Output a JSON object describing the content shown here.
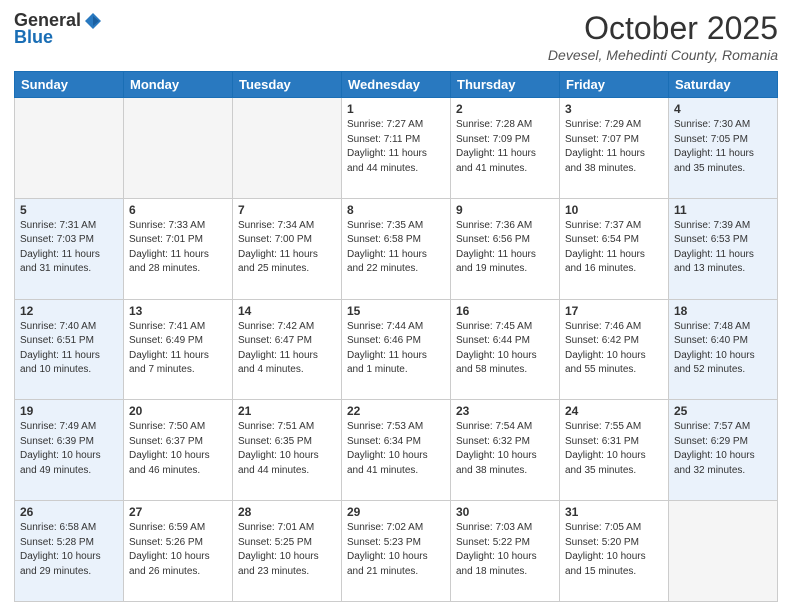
{
  "header": {
    "logo_general": "General",
    "logo_blue": "Blue",
    "month_title": "October 2025",
    "location": "Devesel, Mehedinti County, Romania"
  },
  "days_of_week": [
    "Sunday",
    "Monday",
    "Tuesday",
    "Wednesday",
    "Thursday",
    "Friday",
    "Saturday"
  ],
  "weeks": [
    [
      {
        "day": "",
        "info": ""
      },
      {
        "day": "",
        "info": ""
      },
      {
        "day": "",
        "info": ""
      },
      {
        "day": "1",
        "info": "Sunrise: 7:27 AM\nSunset: 7:11 PM\nDaylight: 11 hours\nand 44 minutes."
      },
      {
        "day": "2",
        "info": "Sunrise: 7:28 AM\nSunset: 7:09 PM\nDaylight: 11 hours\nand 41 minutes."
      },
      {
        "day": "3",
        "info": "Sunrise: 7:29 AM\nSunset: 7:07 PM\nDaylight: 11 hours\nand 38 minutes."
      },
      {
        "day": "4",
        "info": "Sunrise: 7:30 AM\nSunset: 7:05 PM\nDaylight: 11 hours\nand 35 minutes."
      }
    ],
    [
      {
        "day": "5",
        "info": "Sunrise: 7:31 AM\nSunset: 7:03 PM\nDaylight: 11 hours\nand 31 minutes."
      },
      {
        "day": "6",
        "info": "Sunrise: 7:33 AM\nSunset: 7:01 PM\nDaylight: 11 hours\nand 28 minutes."
      },
      {
        "day": "7",
        "info": "Sunrise: 7:34 AM\nSunset: 7:00 PM\nDaylight: 11 hours\nand 25 minutes."
      },
      {
        "day": "8",
        "info": "Sunrise: 7:35 AM\nSunset: 6:58 PM\nDaylight: 11 hours\nand 22 minutes."
      },
      {
        "day": "9",
        "info": "Sunrise: 7:36 AM\nSunset: 6:56 PM\nDaylight: 11 hours\nand 19 minutes."
      },
      {
        "day": "10",
        "info": "Sunrise: 7:37 AM\nSunset: 6:54 PM\nDaylight: 11 hours\nand 16 minutes."
      },
      {
        "day": "11",
        "info": "Sunrise: 7:39 AM\nSunset: 6:53 PM\nDaylight: 11 hours\nand 13 minutes."
      }
    ],
    [
      {
        "day": "12",
        "info": "Sunrise: 7:40 AM\nSunset: 6:51 PM\nDaylight: 11 hours\nand 10 minutes."
      },
      {
        "day": "13",
        "info": "Sunrise: 7:41 AM\nSunset: 6:49 PM\nDaylight: 11 hours\nand 7 minutes."
      },
      {
        "day": "14",
        "info": "Sunrise: 7:42 AM\nSunset: 6:47 PM\nDaylight: 11 hours\nand 4 minutes."
      },
      {
        "day": "15",
        "info": "Sunrise: 7:44 AM\nSunset: 6:46 PM\nDaylight: 11 hours\nand 1 minute."
      },
      {
        "day": "16",
        "info": "Sunrise: 7:45 AM\nSunset: 6:44 PM\nDaylight: 10 hours\nand 58 minutes."
      },
      {
        "day": "17",
        "info": "Sunrise: 7:46 AM\nSunset: 6:42 PM\nDaylight: 10 hours\nand 55 minutes."
      },
      {
        "day": "18",
        "info": "Sunrise: 7:48 AM\nSunset: 6:40 PM\nDaylight: 10 hours\nand 52 minutes."
      }
    ],
    [
      {
        "day": "19",
        "info": "Sunrise: 7:49 AM\nSunset: 6:39 PM\nDaylight: 10 hours\nand 49 minutes."
      },
      {
        "day": "20",
        "info": "Sunrise: 7:50 AM\nSunset: 6:37 PM\nDaylight: 10 hours\nand 46 minutes."
      },
      {
        "day": "21",
        "info": "Sunrise: 7:51 AM\nSunset: 6:35 PM\nDaylight: 10 hours\nand 44 minutes."
      },
      {
        "day": "22",
        "info": "Sunrise: 7:53 AM\nSunset: 6:34 PM\nDaylight: 10 hours\nand 41 minutes."
      },
      {
        "day": "23",
        "info": "Sunrise: 7:54 AM\nSunset: 6:32 PM\nDaylight: 10 hours\nand 38 minutes."
      },
      {
        "day": "24",
        "info": "Sunrise: 7:55 AM\nSunset: 6:31 PM\nDaylight: 10 hours\nand 35 minutes."
      },
      {
        "day": "25",
        "info": "Sunrise: 7:57 AM\nSunset: 6:29 PM\nDaylight: 10 hours\nand 32 minutes."
      }
    ],
    [
      {
        "day": "26",
        "info": "Sunrise: 6:58 AM\nSunset: 5:28 PM\nDaylight: 10 hours\nand 29 minutes."
      },
      {
        "day": "27",
        "info": "Sunrise: 6:59 AM\nSunset: 5:26 PM\nDaylight: 10 hours\nand 26 minutes."
      },
      {
        "day": "28",
        "info": "Sunrise: 7:01 AM\nSunset: 5:25 PM\nDaylight: 10 hours\nand 23 minutes."
      },
      {
        "day": "29",
        "info": "Sunrise: 7:02 AM\nSunset: 5:23 PM\nDaylight: 10 hours\nand 21 minutes."
      },
      {
        "day": "30",
        "info": "Sunrise: 7:03 AM\nSunset: 5:22 PM\nDaylight: 10 hours\nand 18 minutes."
      },
      {
        "day": "31",
        "info": "Sunrise: 7:05 AM\nSunset: 5:20 PM\nDaylight: 10 hours\nand 15 minutes."
      },
      {
        "day": "",
        "info": ""
      }
    ]
  ]
}
